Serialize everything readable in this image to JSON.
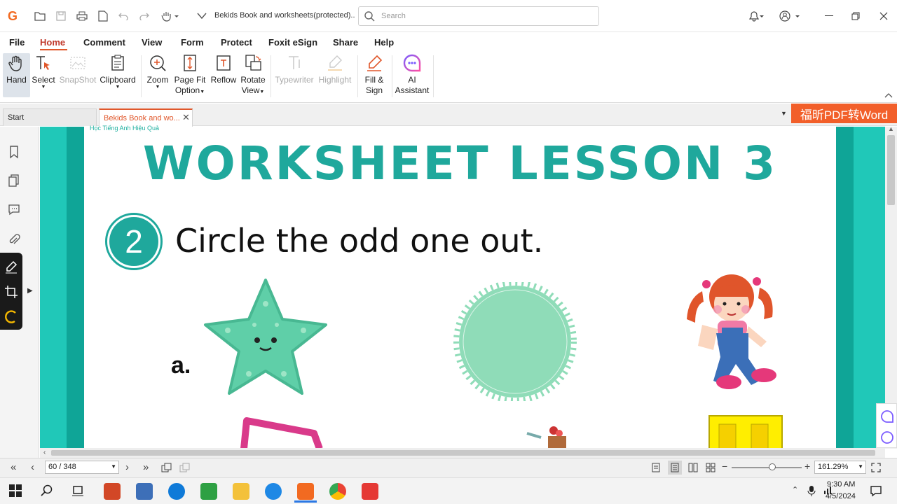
{
  "app": {
    "doc_title": "Bekids Book and worksheets(protected)....",
    "search_placeholder": "Search"
  },
  "menu": [
    "File",
    "Home",
    "Comment",
    "View",
    "Form",
    "Protect",
    "Foxit eSign",
    "Share",
    "Help"
  ],
  "ribbon": {
    "hand": "Hand",
    "select": "Select",
    "snapshot": "SnapShot",
    "clipboard": "Clipboard",
    "zoom": "Zoom",
    "page_fit_1": "Page Fit",
    "page_fit_2": "Option",
    "reflow": "Reflow",
    "rotate_1": "Rotate",
    "rotate_2": "View",
    "typewriter": "Typewriter",
    "highlight": "Highlight",
    "fill_1": "Fill &",
    "fill_2": "Sign",
    "ai_1": "AI",
    "ai_2": "Assistant"
  },
  "tabs": {
    "start": "Start",
    "doc": "Bekids Book and wo...",
    "banner": "福昕PDF转Word"
  },
  "worksheet": {
    "header_small": "Học Tiếng Anh Hiệu Quả",
    "title": "WORKSHEET LESSON 3",
    "number": "2",
    "instruction": "Circle the odd one out.",
    "row_label": "a."
  },
  "status": {
    "page": "60 / 348",
    "zoom": "161.29%"
  },
  "clock": {
    "time": "9:30 AM",
    "date": "4/5/2024"
  },
  "colors": {
    "accent": "#e0572b",
    "teal": "#20c8b8",
    "title_teal": "#1fa89c"
  }
}
